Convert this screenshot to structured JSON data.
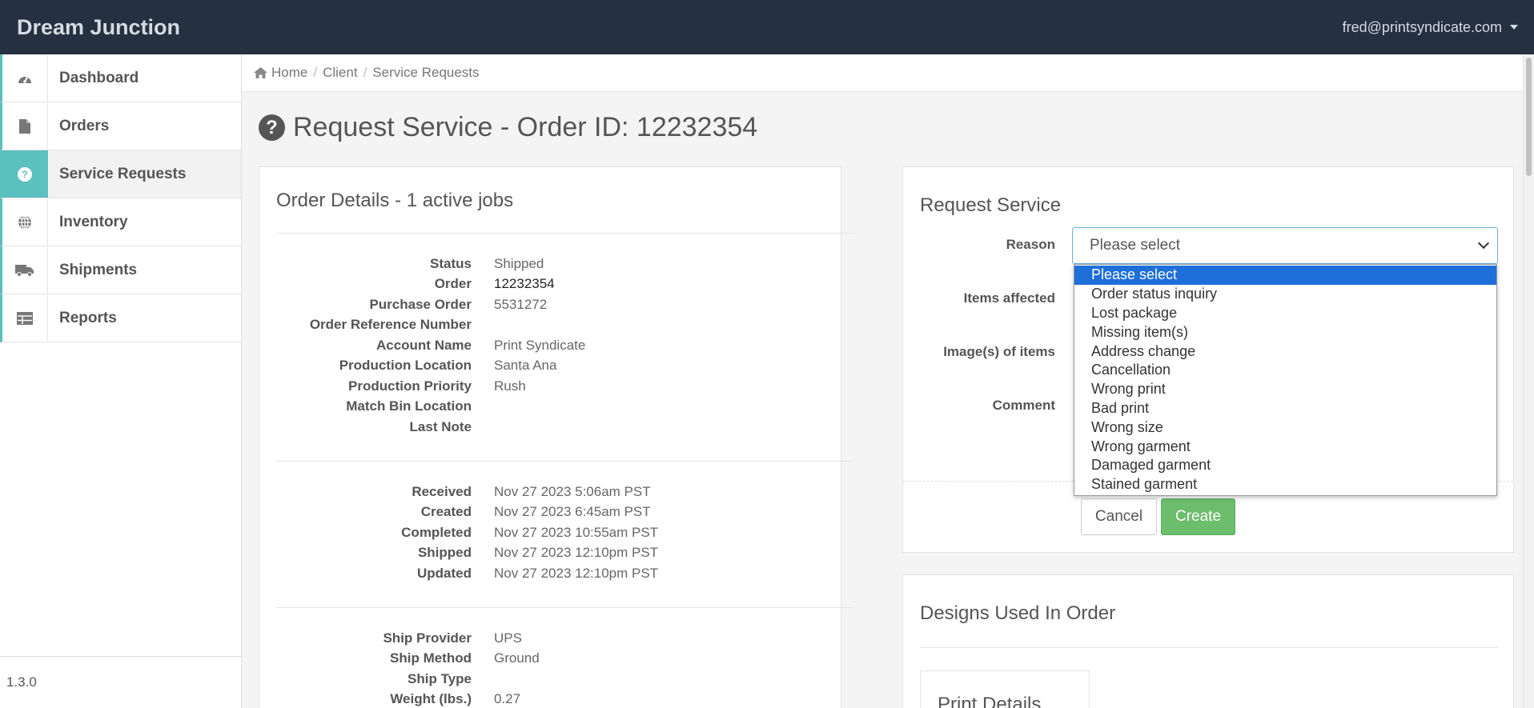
{
  "app": {
    "brand": "Dream Junction",
    "user_email": "fred@printsyndicate.com",
    "version": "1.3.0"
  },
  "sidebar": {
    "items": [
      {
        "label": "Dashboard",
        "icon": "dashboard-icon"
      },
      {
        "label": "Orders",
        "icon": "file-icon"
      },
      {
        "label": "Service Requests",
        "icon": "question-circle-icon",
        "active": true
      },
      {
        "label": "Inventory",
        "icon": "globe-icon"
      },
      {
        "label": "Shipments",
        "icon": "truck-icon"
      },
      {
        "label": "Reports",
        "icon": "table-icon"
      }
    ]
  },
  "breadcrumb": [
    "Home",
    "Client",
    "Service Requests"
  ],
  "page": {
    "title": "Request Service - Order ID: 12232354"
  },
  "order_details": {
    "title": "Order Details - 1 active jobs",
    "group1": [
      {
        "k": "Status",
        "v": "Shipped"
      },
      {
        "k": "Order",
        "v": "12232354"
      },
      {
        "k": "Purchase Order",
        "v": "5531272"
      },
      {
        "k": "Order Reference Number",
        "v": ""
      },
      {
        "k": "Account Name",
        "v": "Print Syndicate"
      },
      {
        "k": "Production Location",
        "v": "Santa Ana"
      },
      {
        "k": "Production Priority",
        "v": "Rush"
      },
      {
        "k": "Match Bin Location",
        "v": ""
      },
      {
        "k": "Last Note",
        "v": ""
      }
    ],
    "group2": [
      {
        "k": "Received",
        "v": "Nov 27 2023 5:06am PST"
      },
      {
        "k": "Created",
        "v": "Nov 27 2023 6:45am PST"
      },
      {
        "k": "Completed",
        "v": "Nov 27 2023 10:55am PST"
      },
      {
        "k": "Shipped",
        "v": "Nov 27 2023 12:10pm PST"
      },
      {
        "k": "Updated",
        "v": "Nov 27 2023 12:10pm PST"
      }
    ],
    "group3": [
      {
        "k": "Ship Provider",
        "v": "UPS"
      },
      {
        "k": "Ship Method",
        "v": "Ground"
      },
      {
        "k": "Ship Type",
        "v": ""
      },
      {
        "k": "Weight (lbs.)",
        "v": "0.27"
      }
    ]
  },
  "request_service": {
    "title": "Request Service",
    "labels": {
      "reason": "Reason",
      "items": "Items affected",
      "images": "Image(s) of items",
      "comment": "Comment"
    },
    "reason_selected": "Please select",
    "options": [
      "Please select",
      "Order status inquiry",
      "Lost package",
      "Missing item(s)",
      "Address change",
      "Cancellation",
      "Wrong print",
      "Bad print",
      "Wrong size",
      "Wrong garment",
      "Damaged garment",
      "Stained garment"
    ],
    "cancel_label": "Cancel",
    "create_label": "Create"
  },
  "designs": {
    "title": "Designs Used In Order",
    "card_title": "Print Details"
  },
  "colors": {
    "navbar": "#253040",
    "accent": "#5bc0be",
    "create": "#6cbd6c",
    "selected_option": "#1e6fd9"
  }
}
